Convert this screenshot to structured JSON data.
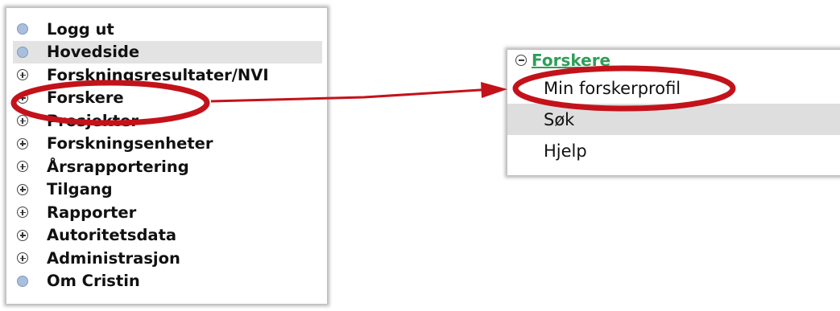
{
  "left_menu": {
    "items": [
      {
        "label": "Logg ut",
        "icon": "dot"
      },
      {
        "label": "Hovedside",
        "icon": "dot"
      },
      {
        "label": "Forskningsresultater/NVI",
        "icon": "plus"
      },
      {
        "label": "Forskere",
        "icon": "plus"
      },
      {
        "label": "Prosjekter",
        "icon": "plus"
      },
      {
        "label": "Forskningsenheter",
        "icon": "plus"
      },
      {
        "label": "Årsrapportering",
        "icon": "plus"
      },
      {
        "label": "Tilgang",
        "icon": "plus"
      },
      {
        "label": "Rapporter",
        "icon": "plus"
      },
      {
        "label": "Autoritetsdata",
        "icon": "plus"
      },
      {
        "label": "Administrasjon",
        "icon": "plus"
      },
      {
        "label": "Om Cristin",
        "icon": "dot"
      }
    ]
  },
  "submenu": {
    "header": "Forskere",
    "items": [
      {
        "label": "Min forskerprofil"
      },
      {
        "label": "Søk"
      },
      {
        "label": "Hjelp"
      }
    ]
  },
  "colors": {
    "annotation_red": "#c4121a",
    "header_green": "#2f9e5a",
    "highlight_gray": "#e3e3e3"
  }
}
